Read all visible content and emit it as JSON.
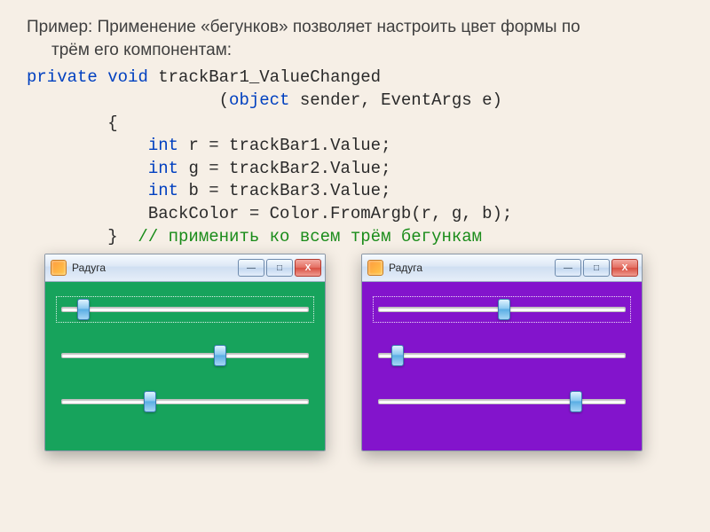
{
  "intro_line1": "Пример: Применение «бегунков» позволяет настроить цвет формы по",
  "intro_line2": "трём его компонентам:",
  "code": {
    "kw_private": "private",
    "kw_void": "void",
    "method_name": " trackBar1_ValueChanged",
    "params_prefix": "                   (",
    "kw_object": "object",
    "params_mid": " sender, EventArgs e)",
    "brace_open": "        {",
    "kw_int1": "int",
    "line_r": " r = trackBar1.Value;",
    "kw_int2": "int",
    "line_g": " g = trackBar2.Value;",
    "kw_int3": "int",
    "line_b": " b = trackBar3.Value;",
    "line_back": "            BackColor = Color.FromArgb(r, g, b);",
    "brace_close": "        }  ",
    "comment": "// применить ко всем трём бегункам",
    "indent12": "            "
  },
  "window": {
    "title": "Радуга",
    "min": "—",
    "max": "□",
    "close": "X"
  },
  "trackbars": {
    "green": [
      {
        "value_percent": 9
      },
      {
        "value_percent": 64
      },
      {
        "value_percent": 36
      }
    ],
    "purple": [
      {
        "value_percent": 51
      },
      {
        "value_percent": 8
      },
      {
        "value_percent": 80
      }
    ]
  },
  "colors": {
    "green_bg": "#17a35c",
    "purple_bg": "#8314cc"
  }
}
